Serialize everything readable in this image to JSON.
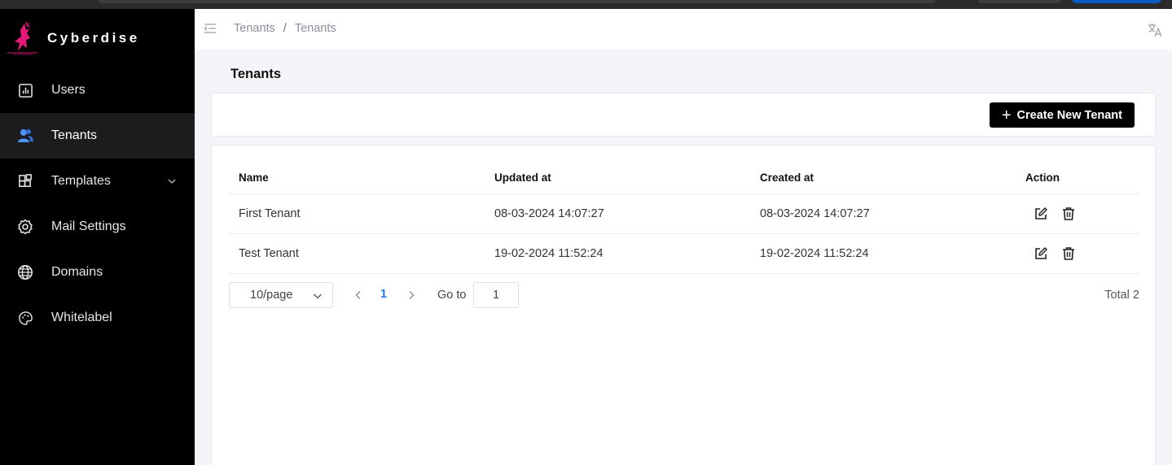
{
  "brand": {
    "name": "Cyberdise",
    "logo": "kangaroo-logo"
  },
  "sidebar": {
    "items": [
      {
        "label": "Users",
        "icon": "bar-chart-icon",
        "active": false
      },
      {
        "label": "Tenants",
        "icon": "users-icon",
        "active": true
      },
      {
        "label": "Templates",
        "icon": "blocks-icon",
        "active": false,
        "expandable": true
      },
      {
        "label": "Mail Settings",
        "icon": "gear-icon",
        "active": false
      },
      {
        "label": "Domains",
        "icon": "globe-icon",
        "active": false
      },
      {
        "label": "Whitelabel",
        "icon": "palette-icon",
        "active": false
      }
    ]
  },
  "header": {
    "breadcrumb": [
      "Tenants",
      "Tenants"
    ],
    "separator": "/"
  },
  "page": {
    "title": "Tenants",
    "create_button": "Create New Tenant"
  },
  "table": {
    "columns": [
      "Name",
      "Updated at",
      "Created at",
      "Action"
    ],
    "rows": [
      {
        "name": "First Tenant",
        "updated_at": "08-03-2024 14:07:27",
        "created_at": "08-03-2024 14:07:27"
      },
      {
        "name": "Test Tenant",
        "updated_at": "19-02-2024 11:52:24",
        "created_at": "19-02-2024 11:52:24"
      }
    ]
  },
  "pagination": {
    "page_size": "10/page",
    "current_page": "1",
    "goto_label": "Go to",
    "goto_value": "1",
    "total": "Total 2"
  },
  "colors": {
    "sidebar_bg": "#000000",
    "active_item_bg": "#1c1c1e",
    "accent_blue": "#1e78e6",
    "button_bg": "#000000",
    "logo_pink": "#e6197a"
  }
}
